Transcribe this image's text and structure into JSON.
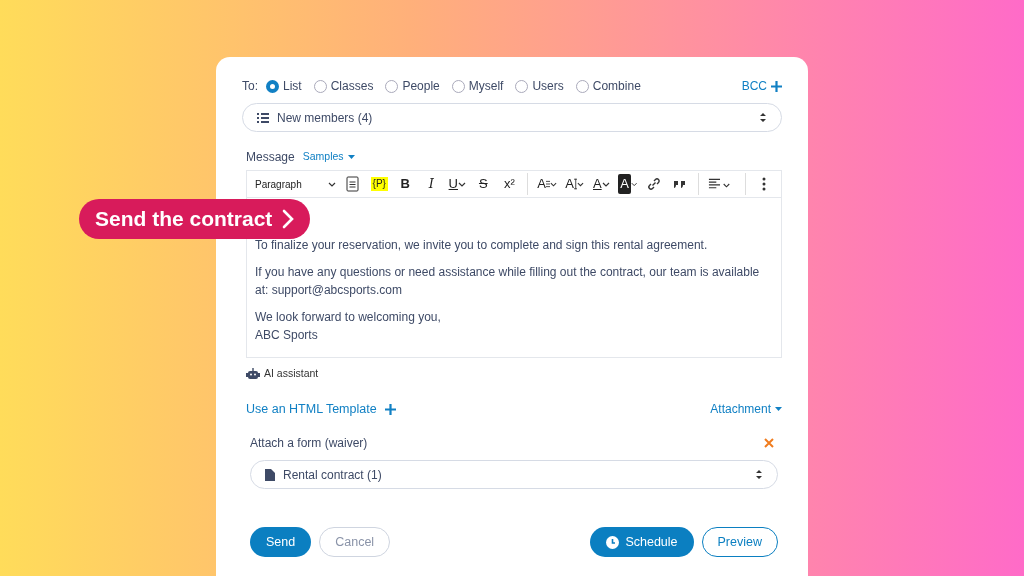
{
  "callout": {
    "label": "Send the contract"
  },
  "recipients": {
    "label": "To:",
    "options": [
      {
        "label": "List",
        "selected": true
      },
      {
        "label": "Classes",
        "selected": false
      },
      {
        "label": "People",
        "selected": false
      },
      {
        "label": "Myself",
        "selected": false
      },
      {
        "label": "Users",
        "selected": false
      },
      {
        "label": "Combine",
        "selected": false
      }
    ],
    "bcc": "BCC"
  },
  "list_select": {
    "value": "New members (4)"
  },
  "message": {
    "label": "Message",
    "samples": "Samples"
  },
  "toolbar": [
    {
      "kind": "select",
      "label": "Paragraph"
    },
    {
      "kind": "icon"
    },
    {
      "kind": "tag",
      "label": "{P}"
    },
    {
      "kind": "bold",
      "label": "B"
    },
    {
      "kind": "italic",
      "label": "I"
    },
    {
      "kind": "underline",
      "label": "U"
    },
    {
      "kind": "strike",
      "label": "S"
    },
    {
      "kind": "plain",
      "label": "x²"
    },
    {
      "kind": "separator"
    },
    {
      "kind": "font-size",
      "label": "A"
    },
    {
      "kind": "line-height",
      "label": "A"
    },
    {
      "kind": "font-color",
      "label": "A"
    },
    {
      "kind": "bg-color",
      "label": "A"
    },
    {
      "kind": "icon"
    },
    {
      "kind": "icon"
    },
    {
      "kind": "separator"
    },
    {
      "kind": "icon"
    },
    {
      "kind": "separator"
    },
    {
      "kind": "icon"
    }
  ],
  "body": [
    {
      "lines": [
        "To finalize your reservation, we invite you to complete and sign this rental agreement."
      ]
    },
    {
      "lines": [
        "If you have any questions or need assistance while filling out the contract, our team is available at: support@abcsports.com"
      ]
    },
    {
      "lines": [
        "We look forward to welcoming you,",
        "ABC Sports"
      ]
    }
  ],
  "ai_assistant": "AI assistant",
  "template_link": "Use an HTML Template",
  "attachment_menu": "Attachment",
  "form": {
    "label": "Attach a form (waiver)",
    "value": "Rental contract (1)"
  },
  "buttons": [
    {
      "kind": "primary",
      "label": "Send"
    },
    {
      "kind": "secondary",
      "label": "Cancel"
    },
    {
      "kind": "schedule",
      "label": "Schedule"
    },
    {
      "kind": "outline",
      "label": "Preview"
    }
  ]
}
